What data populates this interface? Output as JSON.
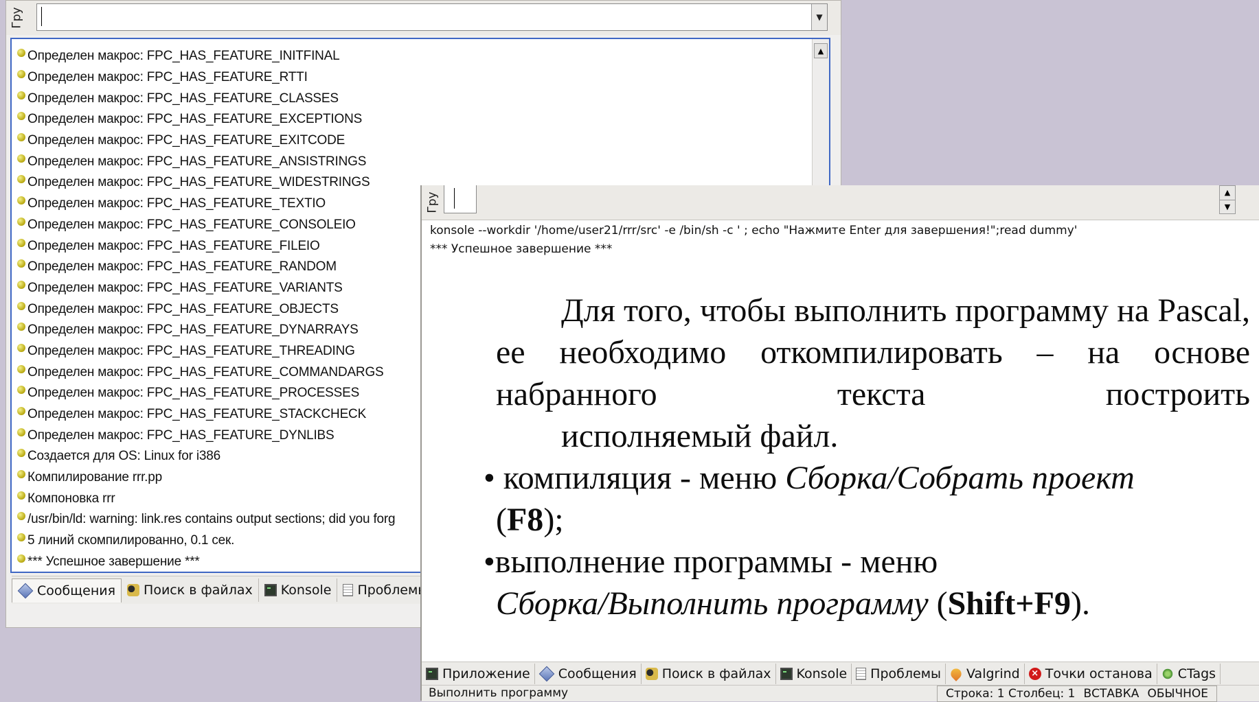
{
  "back_window": {
    "vertical_tab_label": "Гру",
    "messages": [
      "Определен макрос: FPC_HAS_FEATURE_INITFINAL",
      "Определен макрос: FPC_HAS_FEATURE_RTTI",
      "Определен макрос: FPC_HAS_FEATURE_CLASSES",
      "Определен макрос: FPC_HAS_FEATURE_EXCEPTIONS",
      "Определен макрос: FPC_HAS_FEATURE_EXITCODE",
      "Определен макрос: FPC_HAS_FEATURE_ANSISTRINGS",
      "Определен макрос: FPC_HAS_FEATURE_WIDESTRINGS",
      "Определен макрос: FPC_HAS_FEATURE_TEXTIO",
      "Определен макрос: FPC_HAS_FEATURE_CONSOLEIO",
      "Определен макрос: FPC_HAS_FEATURE_FILEIO",
      "Определен макрос: FPC_HAS_FEATURE_RANDOM",
      "Определен макрос: FPC_HAS_FEATURE_VARIANTS",
      "Определен макрос: FPC_HAS_FEATURE_OBJECTS",
      "Определен макрос: FPC_HAS_FEATURE_DYNARRAYS",
      "Определен макрос: FPC_HAS_FEATURE_THREADING",
      "Определен макрос: FPC_HAS_FEATURE_COMMANDARGS",
      "Определен макрос: FPC_HAS_FEATURE_PROCESSES",
      "Определен макрос: FPC_HAS_FEATURE_STACKCHECK",
      "Определен макрос: FPC_HAS_FEATURE_DYNLIBS",
      "Создается для OS: Linux for i386",
      "Компилирование rrr.pp",
      "Компоновка rrr",
      "/usr/bin/ld: warning: link.res contains output sections; did you forg",
      "5 линий скомпилированно, 0.1 сек.",
      "*** Успешное завершение ***"
    ],
    "tabs": [
      {
        "label": "Сообщения",
        "icon": "diamond-icon"
      },
      {
        "label": "Поиск в файлах",
        "icon": "find-icon"
      },
      {
        "label": "Konsole",
        "icon": "terminal-icon"
      },
      {
        "label": "Проблемы",
        "icon": "document-icon"
      }
    ]
  },
  "front_window": {
    "vertical_tab_label": "Гру",
    "console_lines": [
      "konsole --workdir '/home/user21/rrr/src' -e /bin/sh -c ' ; echo \"Нажмите Enter для завершения!\";read dummy'",
      "*** Успешное завершение ***"
    ],
    "slide": {
      "para1_justified": "Для того, чтобы выполнить программу на Pascal, ее необходимо откомпилировать – на основе набранного текста построить",
      "para1_last": "исполняемый файл.",
      "bullet1_prefix": "• компиляция - меню ",
      "bullet1_italic": "Сборка/Собрать проект",
      "bullet1_open": "(",
      "bullet1_bold": "F8",
      "bullet1_close": ");",
      "bullet2_line1": "•выполнение программы - меню",
      "bullet2_italic": "Сборка/Выполнить программу",
      "bullet2_open": " (",
      "bullet2_bold": "Shift+F9",
      "bullet2_close": ")."
    },
    "tabs": [
      {
        "label": "Приложение",
        "icon": "terminal-icon"
      },
      {
        "label": "Сообщения",
        "icon": "diamond-icon"
      },
      {
        "label": "Поиск в файлах",
        "icon": "find-icon"
      },
      {
        "label": "Konsole",
        "icon": "terminal-icon"
      },
      {
        "label": "Проблемы",
        "icon": "document-icon"
      },
      {
        "label": "Valgrind",
        "icon": "rocket-icon"
      },
      {
        "label": "Точки останова",
        "icon": "stop-icon"
      },
      {
        "label": "CTags",
        "icon": "ctags-icon"
      }
    ],
    "status": {
      "left": "Выполнить программу",
      "line_col": "Строка: 1 Столбец: 1",
      "insert_mode": "ВСТАВКА",
      "selection_mode": "ОБЫЧНОЕ"
    }
  },
  "colors": {
    "desktop": "#c9c3d4",
    "focus_border": "#3f67c4",
    "bullet_yellow": "#d9cf3a"
  }
}
